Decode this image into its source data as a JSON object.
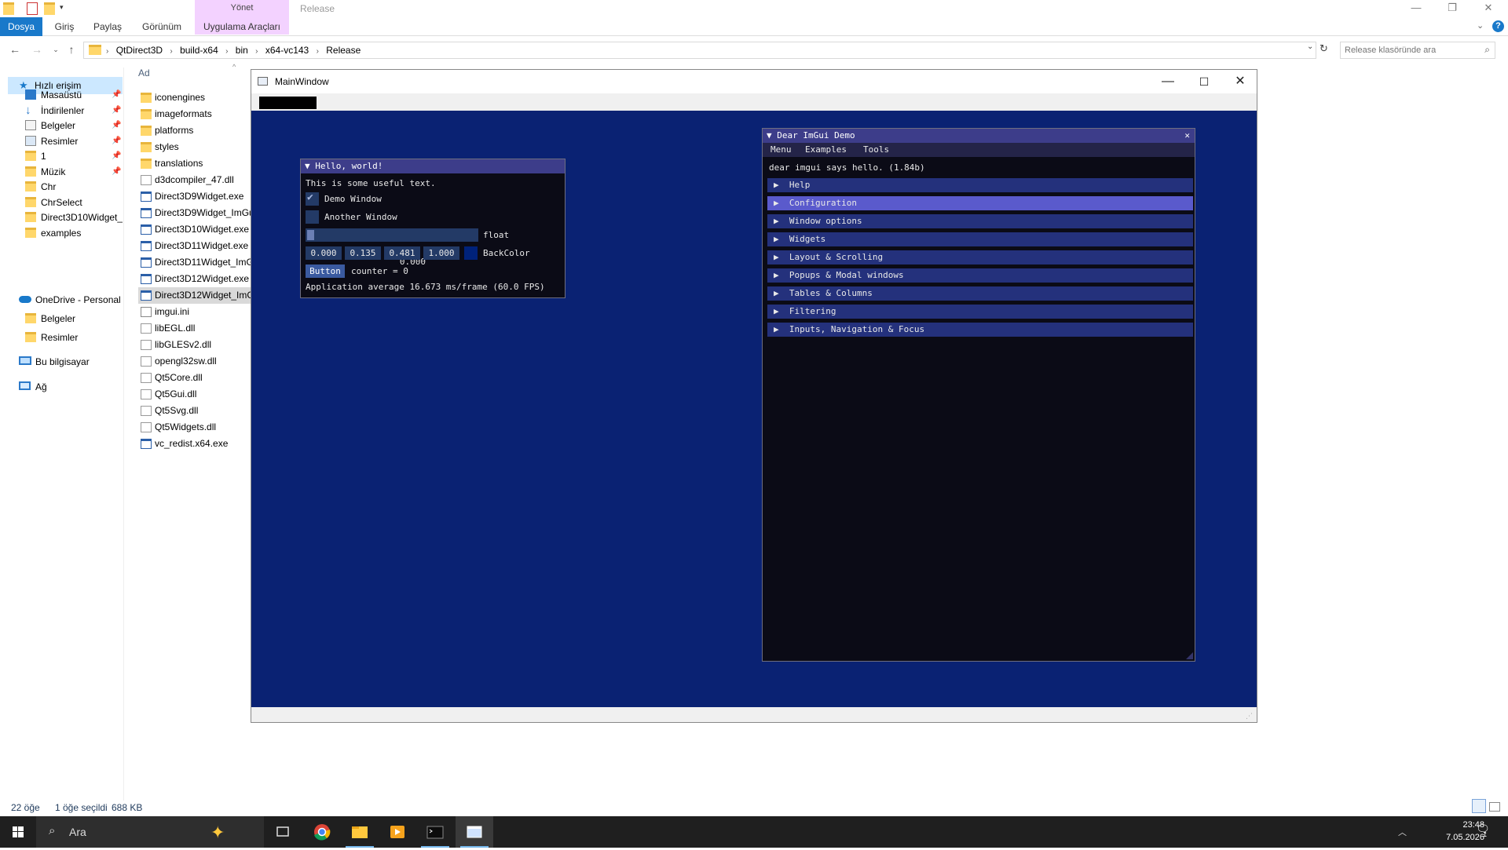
{
  "ribbon": {
    "context_group": "Yönet",
    "window_title": "Release",
    "tabs": [
      "Dosya",
      "Giriş",
      "Paylaş",
      "Görünüm",
      "Uygulama Araçları"
    ],
    "help_glyph": "?"
  },
  "address": {
    "breadcrumbs": [
      "QtDirect3D",
      "build-x64",
      "bin",
      "x64-vc143",
      "Release"
    ],
    "search_placeholder": "Release klasöründe ara"
  },
  "nav_pane": {
    "quick_access": "Hızlı erişim",
    "items": [
      {
        "label": "Masaüstü",
        "icon": "desktop-icon",
        "pinned": true
      },
      {
        "label": "İndirilenler",
        "icon": "download-icon",
        "pinned": true
      },
      {
        "label": "Belgeler",
        "icon": "documents-icon",
        "pinned": true
      },
      {
        "label": "Resimler",
        "icon": "pictures-icon",
        "pinned": true
      },
      {
        "label": "1",
        "icon": "folder-icon",
        "pinned": true
      },
      {
        "label": "Müzik",
        "icon": "folder-icon",
        "pinned": true
      },
      {
        "label": "Chr",
        "icon": "folder-icon",
        "pinned": false
      },
      {
        "label": "ChrSelect",
        "icon": "folder-icon",
        "pinned": false
      },
      {
        "label": "Direct3D10Widget_I",
        "icon": "folder-icon",
        "pinned": false
      },
      {
        "label": "examples",
        "icon": "folder-icon",
        "pinned": false
      }
    ],
    "onedrive": "OneDrive - Personal",
    "onedrive_items": [
      "Belgeler",
      "Resimler"
    ],
    "this_pc": "Bu bilgisayar",
    "network": "Ağ"
  },
  "file_list": {
    "column_name": "Ad",
    "files": [
      {
        "name": "iconengines",
        "type": "folder"
      },
      {
        "name": "imageformats",
        "type": "folder"
      },
      {
        "name": "platforms",
        "type": "folder"
      },
      {
        "name": "styles",
        "type": "folder"
      },
      {
        "name": "translations",
        "type": "folder"
      },
      {
        "name": "d3dcompiler_47.dll",
        "type": "dll"
      },
      {
        "name": "Direct3D9Widget.exe",
        "type": "exe"
      },
      {
        "name": "Direct3D9Widget_ImGu",
        "type": "exe"
      },
      {
        "name": "Direct3D10Widget.exe",
        "type": "exe"
      },
      {
        "name": "Direct3D11Widget.exe",
        "type": "exe"
      },
      {
        "name": "Direct3D11Widget_ImG",
        "type": "exe"
      },
      {
        "name": "Direct3D12Widget.exe",
        "type": "exe"
      },
      {
        "name": "Direct3D12Widget_ImG",
        "type": "exe",
        "selected": true
      },
      {
        "name": "imgui.ini",
        "type": "ini"
      },
      {
        "name": "libEGL.dll",
        "type": "dll"
      },
      {
        "name": "libGLESv2.dll",
        "type": "dll"
      },
      {
        "name": "opengl32sw.dll",
        "type": "dll"
      },
      {
        "name": "Qt5Core.dll",
        "type": "dll"
      },
      {
        "name": "Qt5Gui.dll",
        "type": "dll"
      },
      {
        "name": "Qt5Svg.dll",
        "type": "dll"
      },
      {
        "name": "Qt5Widgets.dll",
        "type": "dll"
      },
      {
        "name": "vc_redist.x64.exe",
        "type": "exe"
      }
    ]
  },
  "status": {
    "count": "22 öğe",
    "selection": "1 öğe seçildi",
    "size": "688 KB"
  },
  "main_window": {
    "title": "MainWindow",
    "minimize": "—",
    "maximize": "☐",
    "close": "✕"
  },
  "hello_window": {
    "title": "▼ Hello, world!",
    "text": "This is some useful text.",
    "demo_window": "Demo Window",
    "demo_checked": true,
    "another_window": "Another Window",
    "another_checked": false,
    "slider_value": "0.000",
    "slider_label": "float",
    "color_r": "0.000",
    "color_g": "0.135",
    "color_b": "0.481",
    "color_a": "1.000",
    "color_label": "BackColor",
    "swatch_color": "#00227a",
    "button": "Button",
    "counter": "counter = 0",
    "fps": "Application average 16.673 ms/frame (60.0 FPS)"
  },
  "demo_window": {
    "title": "▼ Dear ImGui Demo",
    "close": "✕",
    "menu": [
      "Menu",
      "Examples",
      "Tools"
    ],
    "greeting": "dear imgui says hello. (1.84b)",
    "sections": [
      {
        "label": "Help"
      },
      {
        "label": "Configuration",
        "hovered": true
      },
      {
        "label": "Window options"
      },
      {
        "label": "Widgets"
      },
      {
        "label": "Layout & Scrolling"
      },
      {
        "label": "Popups & Modal windows"
      },
      {
        "label": "Tables & Columns"
      },
      {
        "label": "Filtering"
      },
      {
        "label": "Inputs, Navigation & Focus"
      }
    ]
  },
  "taskbar": {
    "search": "Ara",
    "time": "23:48",
    "date": "7.05.2026",
    "notification_count": "1"
  }
}
